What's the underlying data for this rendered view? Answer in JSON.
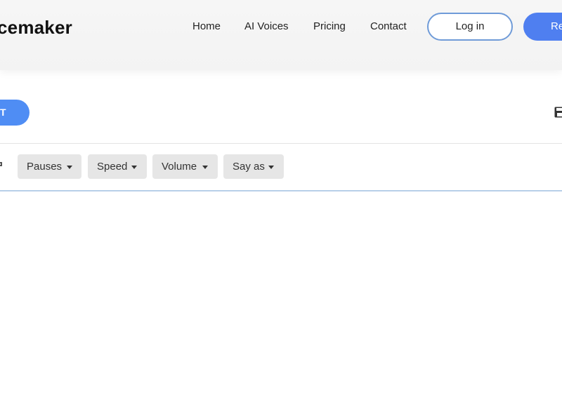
{
  "header": {
    "logo_text": "cemaker",
    "nav": [
      {
        "label": "Home"
      },
      {
        "label": "AI Voices"
      },
      {
        "label": "Pricing"
      },
      {
        "label": "Contact"
      }
    ],
    "login_label": "Log in",
    "register_label": "Re"
  },
  "toolbar": {
    "primary_button_label": "T",
    "save_icon": "save-icon"
  },
  "ssml": {
    "dropdowns": [
      {
        "label": "Pauses"
      },
      {
        "label": "Speed"
      },
      {
        "label": "Volume"
      },
      {
        "label": "Say as"
      }
    ]
  },
  "colors": {
    "accent": "#4f7ff0",
    "pill_blue": "#4f8df4",
    "login_border": "#6f9bd8",
    "editor_border": "#b7cfe8"
  }
}
